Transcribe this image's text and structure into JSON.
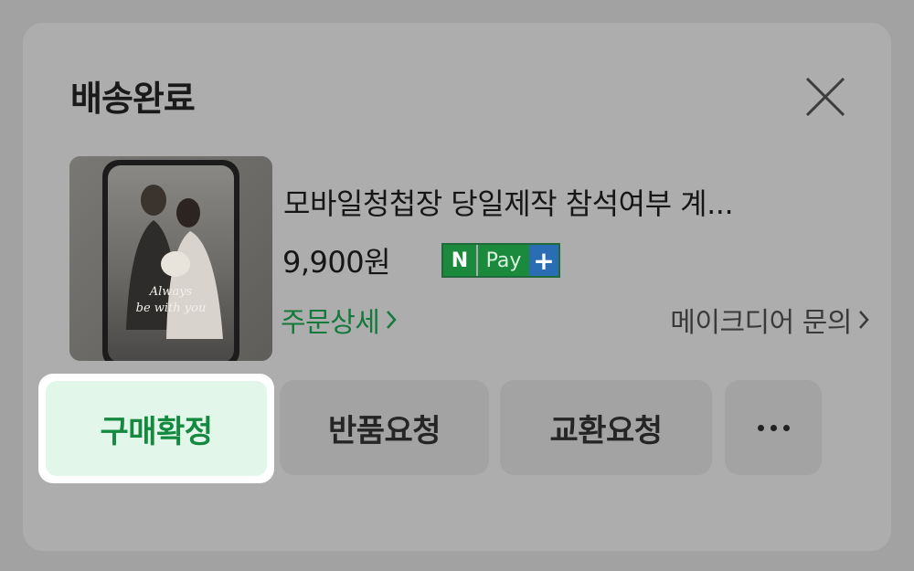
{
  "sheet": {
    "title": "배송완료",
    "close_icon": "close-icon"
  },
  "product": {
    "image_label": "Always be with you",
    "name": "모바일청첩장 당일제작 참석여부 계...",
    "price": "9,900원",
    "npay": {
      "n": "N",
      "pay": "Pay",
      "plus": "+"
    },
    "order_detail_label": "주문상세",
    "inquiry_label": "메이크디어 문의",
    "chevron_icon": "chevron-right-icon"
  },
  "actions": {
    "confirm_label": "구매확정",
    "return_label": "반품요청",
    "exchange_label": "교환요청",
    "more_icon": "more-horizontal-icon"
  },
  "colors": {
    "overlay": "#a2a2a2",
    "card": "#adadad",
    "accent_green": "#14893f",
    "confirm_bg": "#e2f6ea",
    "npay_green": "#1b8a3d",
    "npay_blue": "#2a6db5"
  }
}
